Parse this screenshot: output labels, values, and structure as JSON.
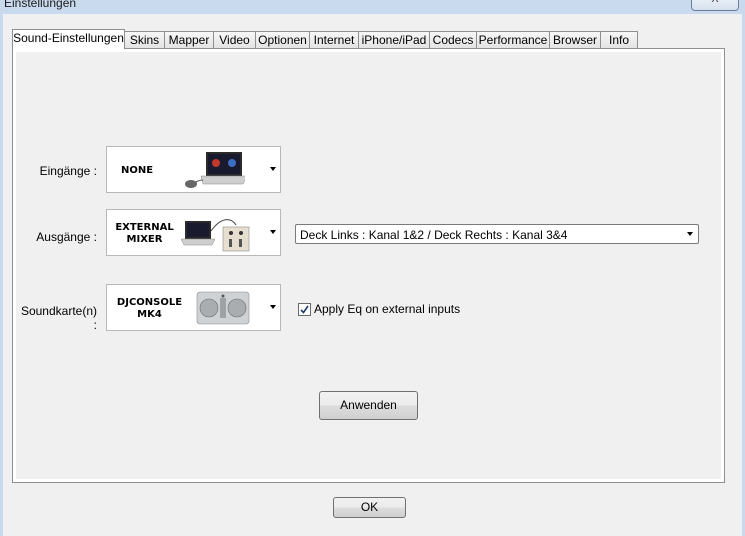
{
  "window": {
    "title": "Einstellungen",
    "close_label": "X"
  },
  "tabs": [
    {
      "label": "Sound-Einstellungen",
      "active": true
    },
    {
      "label": "Skins"
    },
    {
      "label": "Mapper"
    },
    {
      "label": "Video"
    },
    {
      "label": "Optionen"
    },
    {
      "label": "Internet"
    },
    {
      "label": "iPhone/iPad"
    },
    {
      "label": "Codecs"
    },
    {
      "label": "Performance"
    },
    {
      "label": "Browser"
    },
    {
      "label": "Info"
    }
  ],
  "sound": {
    "inputs": {
      "label": "Eingänge :",
      "value": "NONE",
      "icon": "laptop-mouse-icon"
    },
    "outputs": {
      "label": "Ausgänge :",
      "value": "EXTERNAL\nMIXER",
      "icon": "laptop-mixer-icon"
    },
    "soundcard": {
      "label": "Soundkarte(n) :",
      "value": "DJCONSOLE\nMK4",
      "icon": "dj-controller-icon"
    },
    "routing_select": {
      "value": "Deck Links : Kanal 1&2 / Deck Rechts : Kanal 3&4"
    },
    "eq_checkbox": {
      "label": "Apply Eq on external inputs",
      "checked": true
    },
    "apply_button": "Anwenden"
  },
  "ok_button": "OK"
}
